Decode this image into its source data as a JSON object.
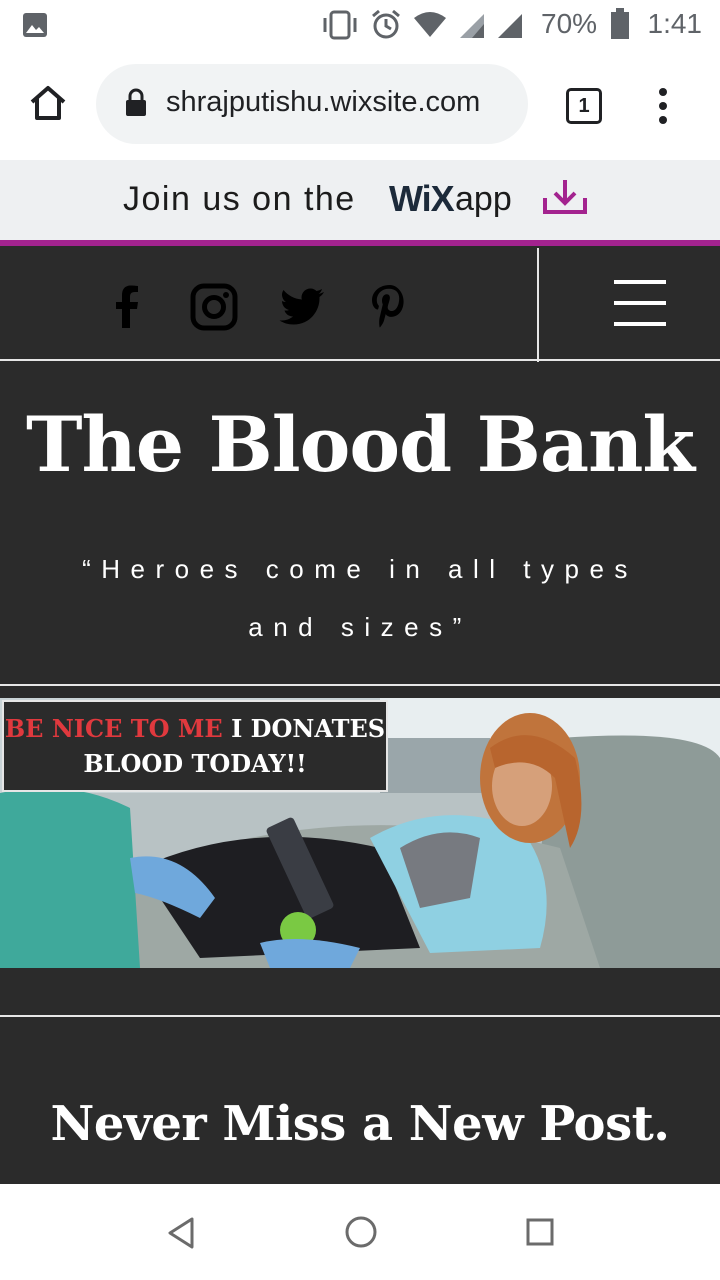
{
  "status_bar": {
    "battery": "70%",
    "time": "1:41",
    "icons": [
      "image-icon",
      "vibrate-icon",
      "alarm-icon",
      "wifi-icon",
      "signal-icon",
      "signal-icon",
      "battery-icon"
    ]
  },
  "browser": {
    "url": "shrajputishu.wixsite.com",
    "tab_count": "1",
    "icons": [
      "home-icon",
      "lock-icon",
      "tabs-icon",
      "more-icon"
    ]
  },
  "wix_banner": {
    "prefix": "Join us on the",
    "logo": "WiX",
    "suffix": "app",
    "accent_color": "#a3238f"
  },
  "header": {
    "social_icons": [
      "facebook-icon",
      "instagram-icon",
      "twitter-icon",
      "pinterest-icon"
    ],
    "menu_icon": "hamburger-icon"
  },
  "hero": {
    "title": "The Blood Bank",
    "tagline_line1": "“Heroes come in all types",
    "tagline_line2": "and sizes”"
  },
  "image_caption": {
    "red_part": "BE NICE TO ME",
    "white_part": "I DONATES BLOOD TODAY!!",
    "red_color": "#e0393e"
  },
  "newsletter": {
    "title": "Never Miss a New Post."
  },
  "nav_bar": {
    "icons": [
      "back-icon",
      "home-circle-icon",
      "recents-icon"
    ]
  }
}
